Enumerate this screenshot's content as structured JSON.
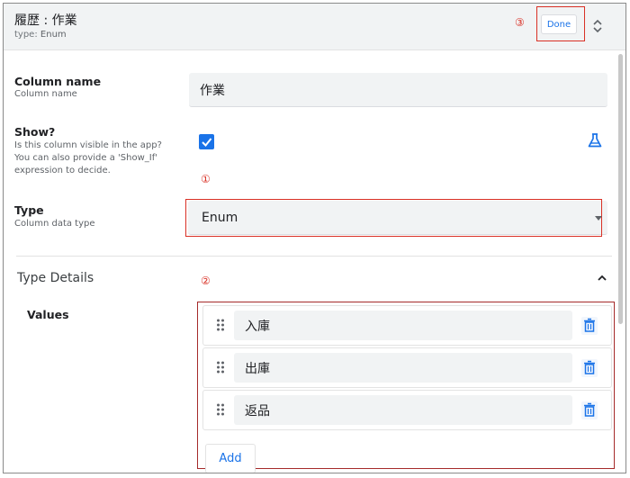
{
  "header": {
    "title": "履歴 : 作業",
    "type_prefix": "type:",
    "type_value": "Enum",
    "done_label": "Done"
  },
  "annotations": {
    "one": "①",
    "two": "②",
    "three": "③"
  },
  "column_name": {
    "label": "Column name",
    "sublabel": "Column name",
    "value": "作業"
  },
  "show": {
    "label": "Show?",
    "sublabel_line1": "Is this column visible in the app?",
    "sublabel_line2": "You can also provide a 'Show_If'",
    "sublabel_line3": "expression to decide.",
    "checked": true
  },
  "type": {
    "label": "Type",
    "sublabel": "Column data type",
    "selected": "Enum"
  },
  "type_details": {
    "title": "Type Details",
    "values_label": "Values",
    "values": [
      "入庫",
      "出庫",
      "返品"
    ],
    "add_label": "Add"
  },
  "colors": {
    "accent": "#1a73e8",
    "annotation_red": "#d93025"
  }
}
